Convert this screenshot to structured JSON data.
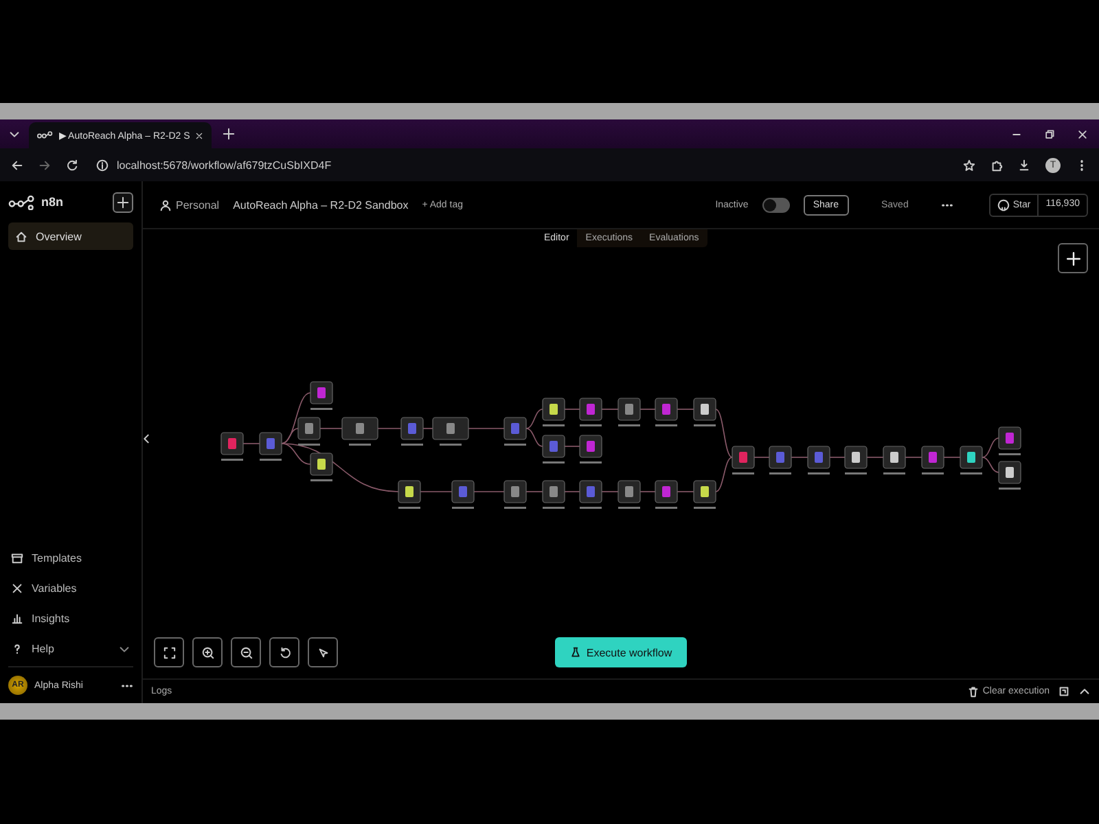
{
  "browser": {
    "tab_title": "▶ AutoReach Alpha – R2-D2 S",
    "url": "localhost:5678/workflow/af679tzCuSbIXD4F",
    "profile_initial": "T"
  },
  "sidebar": {
    "brand": "n8n",
    "items": [
      {
        "label": "Overview",
        "selected": true
      }
    ],
    "bottom_items": [
      {
        "label": "Templates",
        "kind": "templates"
      },
      {
        "label": "Variables",
        "kind": "variables"
      },
      {
        "label": "Insights",
        "kind": "insights"
      },
      {
        "label": "Help",
        "kind": "help"
      }
    ],
    "user": {
      "initials": "AR",
      "name": "Alpha Rishi"
    }
  },
  "header": {
    "project": "Personal",
    "workflow_name": "AutoReach Alpha – R2-D2 Sandbox",
    "add_tag": "+ Add tag",
    "status_label": "Inactive",
    "active": false,
    "share": "Share",
    "save_state": "Saved",
    "github": {
      "label": "Star",
      "count": "116,930"
    }
  },
  "view_tabs": [
    {
      "label": "Editor",
      "selected": true
    },
    {
      "label": "Executions",
      "selected": false
    },
    {
      "label": "Evaluations",
      "selected": false
    }
  ],
  "execute_button": "Execute workflow",
  "logs": {
    "title": "Logs",
    "clear": "Clear execution"
  }
}
